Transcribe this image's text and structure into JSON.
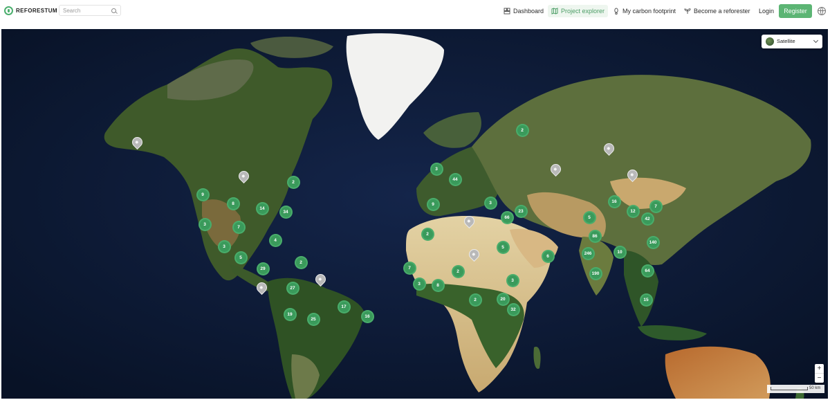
{
  "header": {
    "logo_text": "REFORESTUM",
    "search": {
      "placeholder": "Search",
      "value": ""
    },
    "nav": [
      {
        "label": "Dashboard",
        "icon": "dashboard-icon"
      },
      {
        "label": "Project explorer",
        "icon": "map-icon",
        "active": true
      },
      {
        "label": "My carbon footprint",
        "icon": "footprint-icon"
      },
      {
        "label": "Become a reforester",
        "icon": "sprout-icon"
      }
    ],
    "login_label": "Login",
    "register_label": "Register",
    "language_icon": "globe-icon"
  },
  "map": {
    "layer_select": {
      "selected": "Satellite"
    },
    "zoom_in": "+",
    "zoom_out": "−",
    "scale_label": "50 km",
    "clusters": [
      "2",
      "3",
      "44",
      "9",
      "3",
      "23",
      "66",
      "16",
      "12",
      "7",
      "5",
      "42",
      "2",
      "86",
      "140",
      "5",
      "10",
      "246",
      "6",
      "7",
      "2",
      "3",
      "3",
      "8",
      "190",
      "64",
      "2",
      "20",
      "32",
      "15",
      "9",
      "8",
      "14",
      "34",
      "2",
      "3",
      "7",
      "3",
      "5",
      "4",
      "29",
      "2",
      "27",
      "17",
      "16",
      "19",
      "25"
    ],
    "accent_color": "#3a9a5b"
  }
}
